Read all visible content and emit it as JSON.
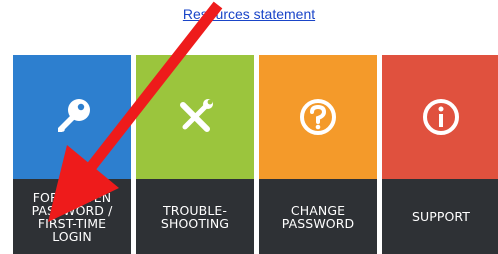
{
  "top_link": {
    "text": "Resources statement"
  },
  "tiles": [
    {
      "label": "FORGOTTEN\nPASSWORD /\nFIRST-TIME\nLOGIN",
      "color": "#2d7fcf",
      "icon": "key-icon"
    },
    {
      "label": "TROUBLE-\nSHOOTING",
      "color": "#9bc53d",
      "icon": "tools-icon"
    },
    {
      "label": "CHANGE\nPASSWORD",
      "color": "#f49a2a",
      "icon": "question-circle-icon"
    },
    {
      "label": "SUPPORT",
      "color": "#e0513e",
      "icon": "info-circle-icon"
    }
  ],
  "annotation": {
    "color": "#ee1b1b",
    "icon": "red-arrow"
  }
}
